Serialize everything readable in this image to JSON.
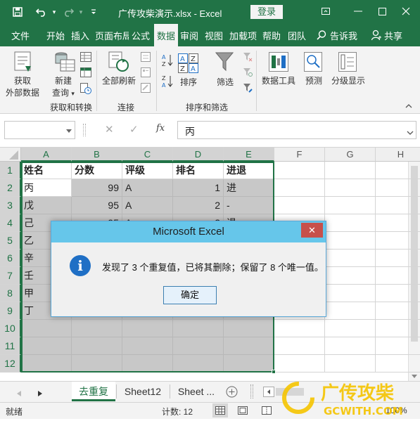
{
  "window": {
    "title": "广传攻柴演示.xlsx  -  Excel",
    "login_label": "登录",
    "qat_dropdown": "▾",
    "colors": {
      "excel_green": "#217346",
      "dialog_title": "#66c6ea",
      "selection_gray": "#c8c8c8"
    }
  },
  "ribbon_tabs": [
    "文件",
    "开始",
    "插入",
    "页面布局",
    "公式",
    "数据",
    "审阅",
    "视图",
    "加载项",
    "帮助",
    "团队",
    "告诉我",
    "共享"
  ],
  "ribbon": {
    "get_external_data": [
      "获取",
      "外部数据"
    ],
    "new_query": [
      "新建",
      "查询"
    ],
    "new_query_arrow": "▾",
    "refresh_all": "全部刷新",
    "sort_az_top": "A",
    "sort_az_bottom": "Z",
    "sort_za_top": "Z",
    "sort_za_bottom": "A",
    "sort_a1": "A",
    "sort_z1": "Z",
    "sort": "排序",
    "filter": "筛选",
    "data_tools": "数据工具",
    "forecast": "预测",
    "outline": "分级显示",
    "groups": {
      "get_transform": "获取和转换",
      "connections": "连接",
      "sort_filter": "排序和筛选"
    }
  },
  "formula_bar": {
    "cancel": "✕",
    "enter": "✓",
    "fx": "fx",
    "content": "丙"
  },
  "columns": [
    "A",
    "B",
    "C",
    "D",
    "E",
    "F",
    "G",
    "H"
  ],
  "rows": [
    "1",
    "2",
    "3",
    "4",
    "5",
    "6",
    "7",
    "8",
    "9",
    "10",
    "11",
    "12"
  ],
  "table": {
    "headers": [
      "姓名",
      "分数",
      "评级",
      "排名",
      "进退"
    ],
    "rows": [
      [
        "丙",
        "99",
        "A",
        "1",
        "进"
      ],
      [
        "戊",
        "95",
        "A",
        "2",
        "-"
      ],
      [
        "己",
        "95",
        "A",
        "2",
        "退"
      ],
      [
        "乙",
        "",
        "",
        "",
        ""
      ],
      [
        "辛",
        "",
        "",
        "",
        ""
      ],
      [
        "壬",
        "",
        "",
        "",
        ""
      ],
      [
        "甲",
        "",
        "",
        "",
        ""
      ],
      [
        "丁",
        "",
        "",
        "",
        ""
      ]
    ]
  },
  "sheets": [
    "去重复",
    "Sheet12",
    "Sheet ..."
  ],
  "status": {
    "ready": "就绪",
    "count": "计数: 12",
    "zoom": "100%"
  },
  "dialog": {
    "title": "Microsoft Excel",
    "close": "✕",
    "info_icon": "i",
    "message": "发现了 3 个重复值，已将其删除；保留了 8 个唯一值。",
    "ok": "确定"
  },
  "watermark": {
    "line1": "广传攻柴",
    "line2": "GCWITH.COM"
  }
}
